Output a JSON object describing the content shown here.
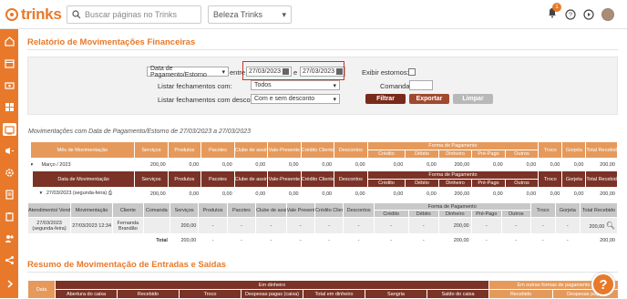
{
  "header": {
    "logo_text": "trinks",
    "search_placeholder": "Buscar páginas no Trinks",
    "company_select": "Beleza Trinks",
    "notification_count": "1"
  },
  "page": {
    "title": "Relatório de Movimentações Financeiras",
    "subtitle": "Movimentações com Data de Pagamento/Estorno de 27/03/2023 a 27/03/2023"
  },
  "filters": {
    "date_type": "Data de Pagamento/Estorno",
    "between_label": "entre",
    "date_from": "27/03/2023",
    "and_label": "e",
    "date_to": "27/03/2023",
    "show_reversals_label": "Exibir estornos:",
    "list_closings_label": "Listar fechamentos com:",
    "list_closings_value": "Todos",
    "command_label": "Comanda:",
    "list_discount_label": "Listar fechamentos com desconto:",
    "list_discount_value": "Com e sem desconto",
    "filter_btn": "Filtrar",
    "export_btn": "Exportar",
    "clear_btn": "Limpar"
  },
  "table1": {
    "month_header": [
      "Mês de Movimentação",
      "Serviços",
      "Produtos",
      "Pacotes",
      "Clube de assinaturas",
      "Vale-Presente",
      "Crédito Cliente",
      "Descontos",
      "Crédito",
      "Débito",
      "Dinheiro",
      "Pré-Pago",
      "Outros",
      "Troco",
      "Gorjeta",
      "Total Recebido"
    ],
    "forma_pagamento": "Forma de Pagamento",
    "month_row": [
      "Março / 2023",
      "200,00",
      "0,00",
      "0,00",
      "0,00",
      "0,00",
      "0,00",
      "0,00",
      "0,00",
      "0,00",
      "200,00",
      "0,00",
      "0,00",
      "0,00",
      "0,00",
      "200,00"
    ],
    "day_header": [
      "Data de Movimentação",
      "Serviços",
      "Produtos",
      "Pacotes",
      "Clube de assinaturas",
      "Vale-Presente",
      "Crédito Cliente",
      "Descontos",
      "Crédito",
      "Débito",
      "Dinheiro",
      "Pré-Pago",
      "Outros",
      "Troco",
      "Gorjeta",
      "Total Recebido"
    ],
    "day_row": [
      "27/03/2023 (segunda-feira)",
      "200,00",
      "0,00",
      "0,00",
      "0,00",
      "0,00",
      "0,00",
      "0,00",
      "0,00",
      "0,00",
      "200,00",
      "0,00",
      "0,00",
      "0,00",
      "0,00",
      "200,00"
    ],
    "detail_header": [
      "Atendimento/ Venda",
      "Movimentação",
      "Cliente",
      "Comanda",
      "Serviços",
      "Produtos",
      "Pacotes",
      "Clube de assinaturas",
      "Vale Presente",
      "Crédito Cliente",
      "Descontos",
      "Crédito",
      "Débito",
      "Dinheiro",
      "Pré-Pago",
      "Outros",
      "Troco",
      "Gorjeta",
      "Total Recebido"
    ],
    "detail_row": [
      "27/03/2023 (segunda-feira)",
      "27/03/2023 12:34",
      "Fernanda Brandão",
      "",
      "200,00",
      "-",
      "-",
      "-",
      "-",
      "-",
      "-",
      "-",
      "-",
      "200,00",
      "-",
      "-",
      "-",
      "-",
      "200,00"
    ],
    "total_row": [
      "Total",
      "200,00",
      "-",
      "-",
      "-",
      "-",
      "-",
      "-",
      "-",
      "-",
      "200,00",
      "-",
      "-",
      "-",
      "-",
      "200,00"
    ]
  },
  "section2": {
    "title": "Resumo de Movimentação de Entradas e Saídas",
    "data": "Data",
    "em_dinheiro": "Em dinheiro",
    "outras_formas": "Em outras formas de pagamento",
    "cols": [
      "Abertura do caixa",
      "Recebido",
      "Troco",
      "Despesas pagas (caixa)",
      "Total em dinheiro",
      "Sangria",
      "Saldo do caixa",
      "Recebido",
      "Despesas pagas"
    ]
  },
  "colors": {
    "accent": "#e8792b",
    "header_orange": "#e59a5c",
    "header_brown": "#7a3326",
    "btn_dark": "#7a2a1a",
    "btn_mid": "#a0492f"
  }
}
